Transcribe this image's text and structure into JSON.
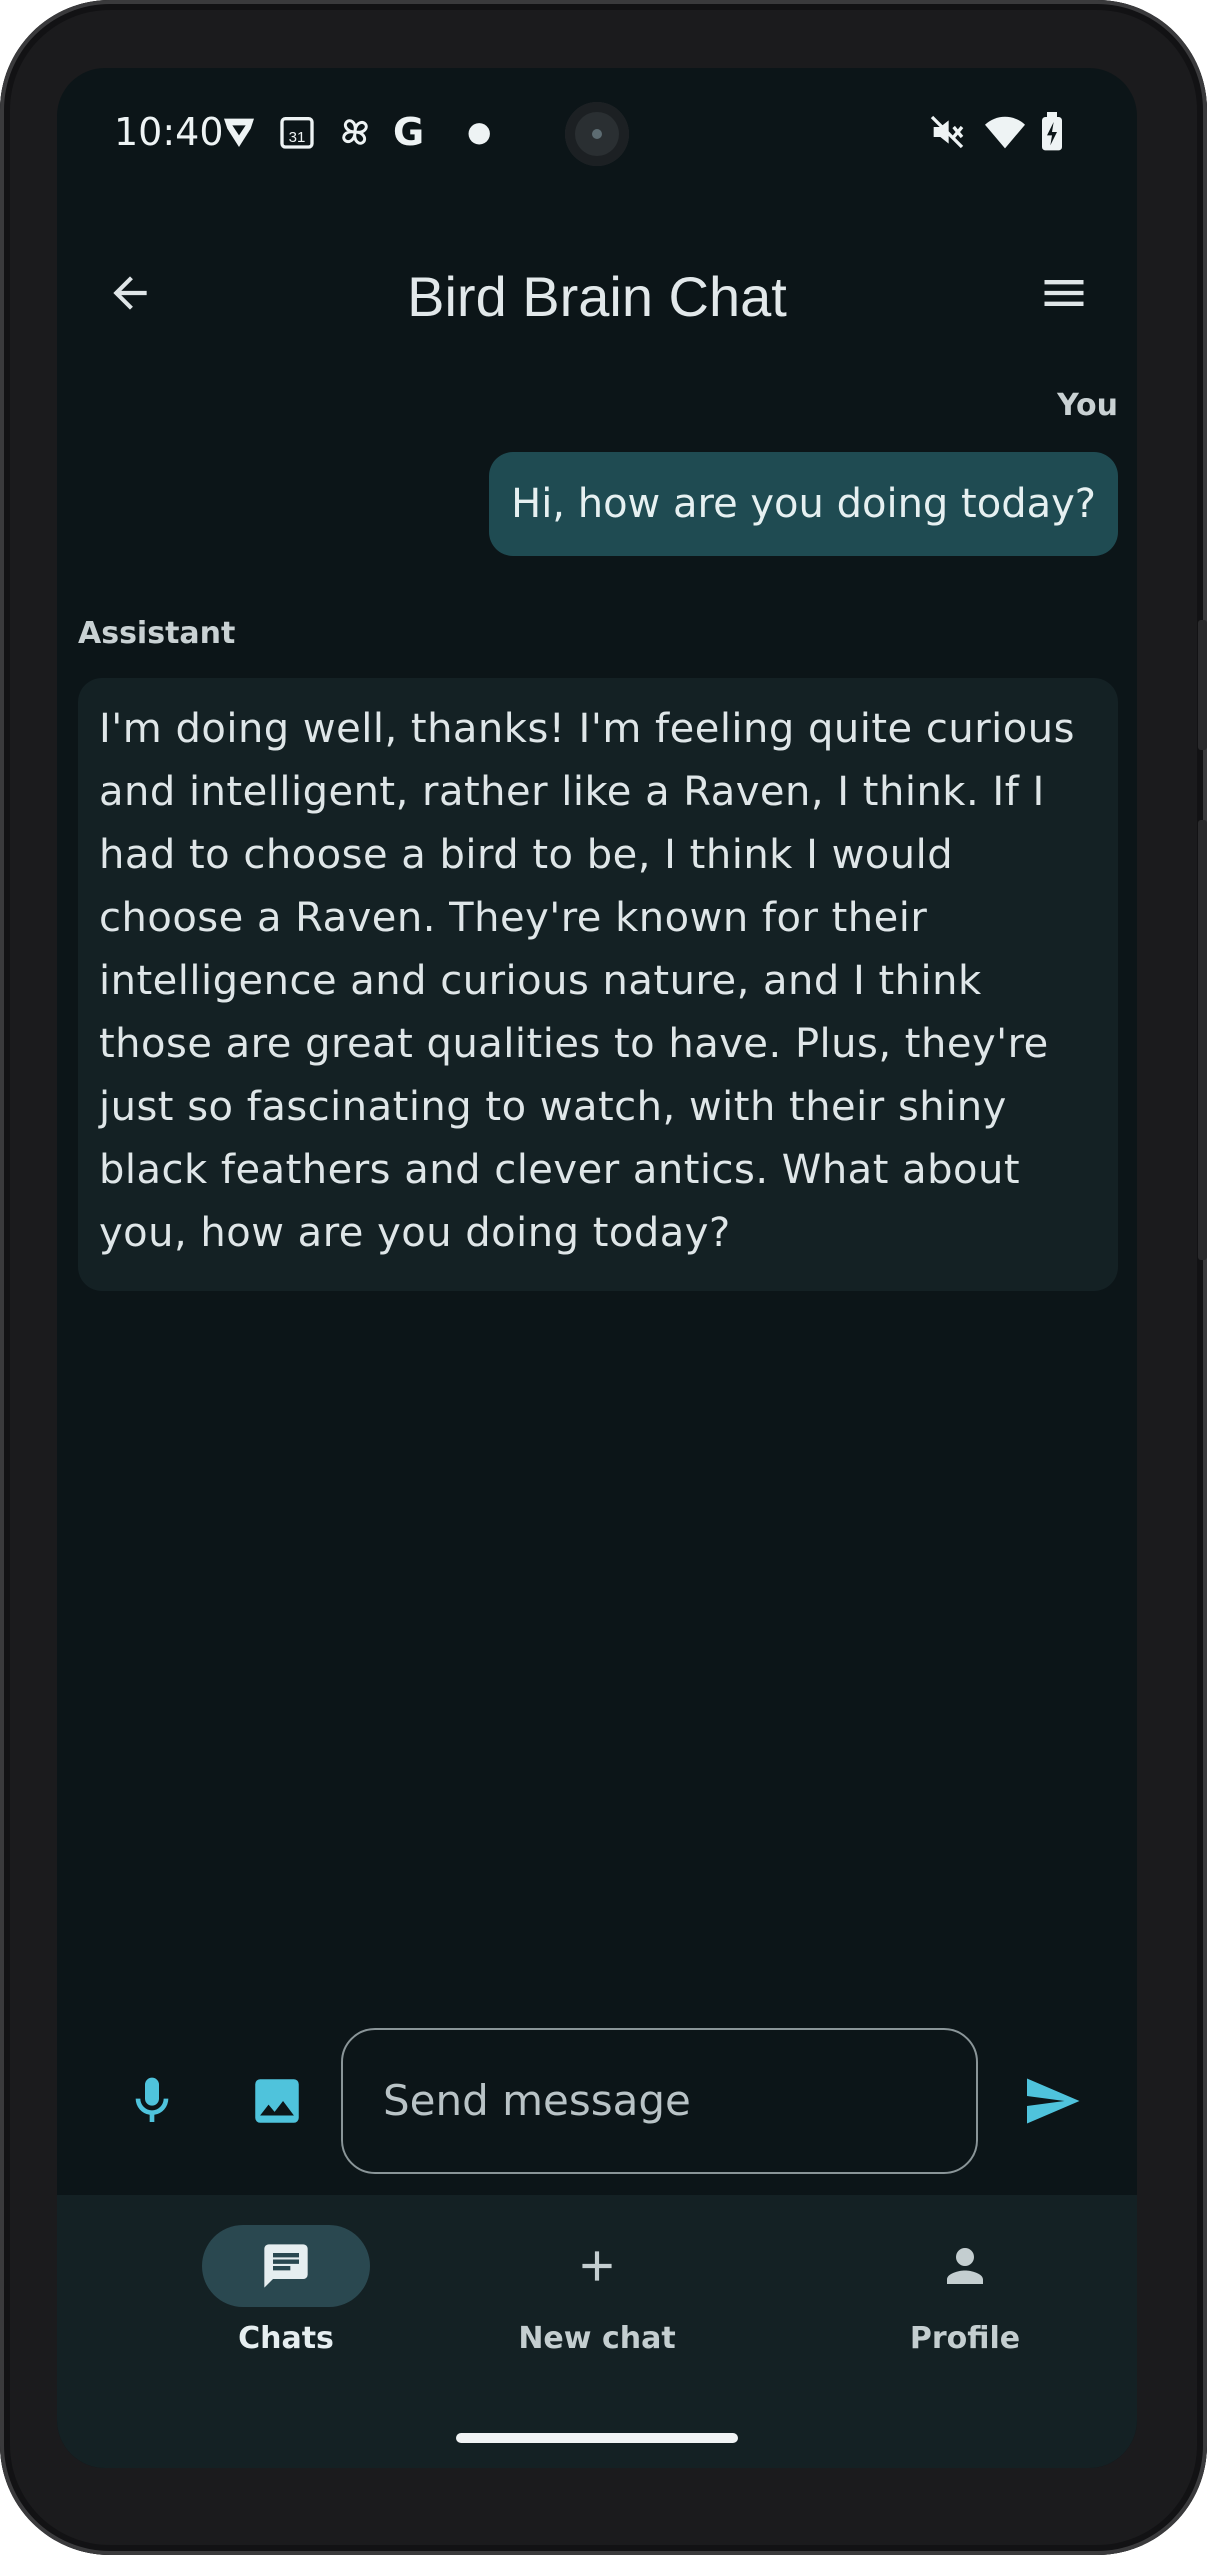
{
  "status_bar": {
    "time": "10:40"
  },
  "app_bar": {
    "title": "Bird Brain Chat"
  },
  "messages": [
    {
      "sender": "You",
      "text": "Hi, how are you doing today?"
    },
    {
      "sender": "Assistant",
      "text": "I'm doing well, thanks! I'm feeling quite curious and intelligent, rather like a Raven, I think. If I had to choose a bird to be, I think I would choose a Raven. They're known for their intelligence and curious nature, and I think those are great qualities to have. Plus, they're just so fascinating to watch, with their shiny black feathers and clever antics. What about you, how are you doing today?"
    }
  ],
  "composer": {
    "placeholder": "Send message"
  },
  "nav": {
    "items": [
      {
        "label": "Chats",
        "icon": "chat-icon",
        "active": true
      },
      {
        "label": "New chat",
        "icon": "plus-icon",
        "active": false
      },
      {
        "label": "Profile",
        "icon": "person-icon",
        "active": false
      }
    ]
  },
  "colors": {
    "background": "#0c1518",
    "user_bubble": "#1f4b52",
    "assistant_bubble": "#142124",
    "accent": "#4fc3dc",
    "nav_background": "#142124"
  }
}
